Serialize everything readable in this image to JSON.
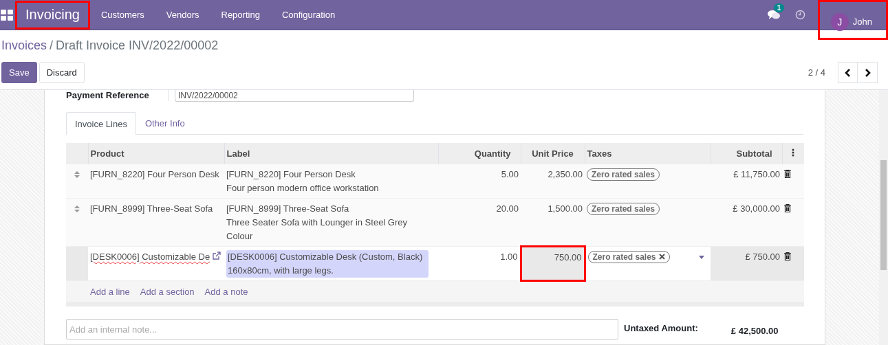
{
  "navbar": {
    "app_name": "Invoicing",
    "app_highlighted": true,
    "menu": [
      "Customers",
      "Vendors",
      "Reporting",
      "Configuration"
    ],
    "message_count": "1",
    "user": {
      "initial": "J",
      "name": "John",
      "highlighted": true
    }
  },
  "breadcrumb": {
    "parent": "Invoices",
    "separator": "/",
    "current": "Draft Invoice INV/2022/00002"
  },
  "buttons": [
    {
      "label": "Save",
      "kind": "primary"
    },
    {
      "label": "Discard",
      "kind": "secondary"
    }
  ],
  "pager": "2 / 4",
  "payment_reference": {
    "label": "Payment Reference",
    "value": "INV/2022/00002"
  },
  "tabs": [
    {
      "label": "Invoice Lines",
      "selected": true
    },
    {
      "label": "Other Info",
      "selected": false
    }
  ],
  "table": {
    "columns": [
      "Product",
      "Label",
      "Quantity",
      "Unit Price",
      "Taxes",
      "Subtotal"
    ],
    "rows": [
      {
        "product": "[FURN_8220] Four Person Desk",
        "label": [
          "[FURN_8220] Four Person Desk",
          "Four person modern office workstation"
        ],
        "quantity": "5.00",
        "unit_price": "2,350.00",
        "tax": "Zero rated sales",
        "subtotal": "£ 11,750.00",
        "editing": false,
        "price_highlighted": false
      },
      {
        "product": "[FURN_8999] Three-Seat Sofa",
        "label": [
          "[FURN_8999] Three-Seat Sofa",
          "Three Seater Sofa with Lounger in Steel Grey Colour"
        ],
        "quantity": "20.00",
        "unit_price": "1,500.00",
        "tax": "Zero rated sales",
        "subtotal": "£ 30,000.00",
        "editing": false,
        "price_highlighted": false
      },
      {
        "product": "[DESK0006] Customizable De",
        "label": [
          "[DESK0006] Customizable Desk (Custom, Black)",
          "160x80cm, with large legs."
        ],
        "quantity": "1.00",
        "unit_price": "750.00",
        "tax": "Zero rated sales",
        "subtotal": "£ 750.00",
        "editing": true,
        "price_highlighted": true
      }
    ],
    "add_links": [
      "Add a line",
      "Add a section",
      "Add a note"
    ]
  },
  "note": {
    "placeholder": "Add an internal note..."
  },
  "totals": {
    "label": "Untaxed Amount:",
    "value": "£ 42,500.00"
  }
}
